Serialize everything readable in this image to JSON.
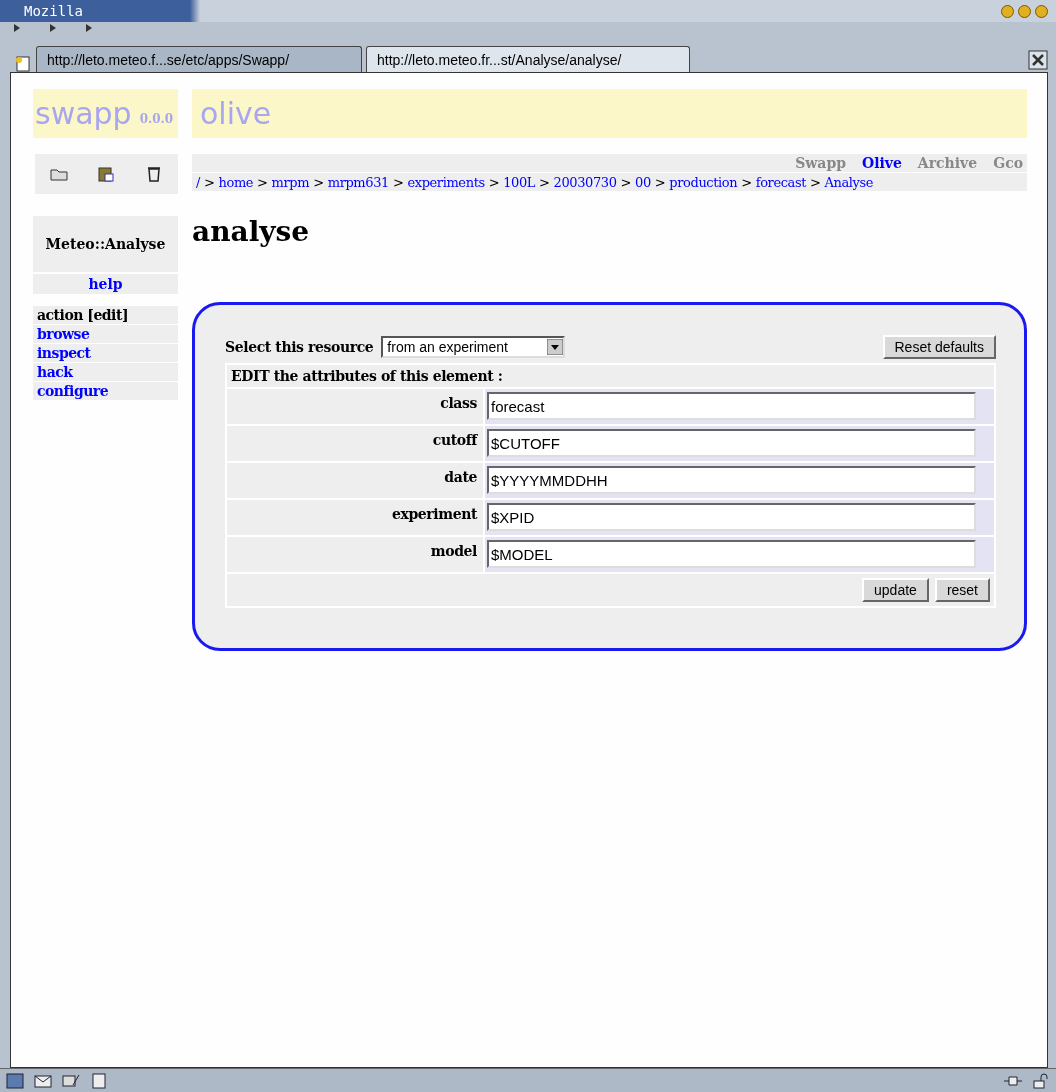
{
  "window": {
    "title": "Mozilla"
  },
  "tabs": [
    {
      "label": "http://leto.meteo.f...se/etc/apps/Swapp/",
      "selected": false
    },
    {
      "label": "http://leto.meteo.fr...st/Analyse/analyse/",
      "selected": true
    }
  ],
  "header": {
    "logo": "swapp",
    "version": "0.0.0",
    "title": "olive"
  },
  "nav": [
    {
      "label": "Swapp",
      "selected": false
    },
    {
      "label": "Olive",
      "selected": true
    },
    {
      "label": "Archive",
      "selected": false
    },
    {
      "label": "Gco",
      "selected": false
    }
  ],
  "breadcrumb": {
    "separator": ">",
    "items": [
      "/",
      "home",
      "mrpm",
      "mrpm631",
      "experiments",
      "100L",
      "20030730",
      "00",
      "production",
      "forecast",
      "Analyse"
    ]
  },
  "sidebar": {
    "module": "Meteo::Analyse",
    "help": "help",
    "actions": [
      {
        "label": "action [edit]",
        "selected": true
      },
      {
        "label": "browse",
        "selected": false
      },
      {
        "label": "inspect",
        "selected": false
      },
      {
        "label": "hack",
        "selected": false
      },
      {
        "label": "configure",
        "selected": false
      }
    ]
  },
  "heading": "analyse",
  "form": {
    "select_label": "Select this resource",
    "select_value": "from an experiment",
    "reset_defaults": "Reset defaults",
    "section": "EDIT the attributes of this element :",
    "fields": [
      {
        "label": "class",
        "value": "forecast"
      },
      {
        "label": "cutoff",
        "value": "$CUTOFF"
      },
      {
        "label": "date",
        "value": "$YYYYMMDDHH"
      },
      {
        "label": "experiment",
        "value": "$XPID"
      },
      {
        "label": "model",
        "value": "$MODEL"
      }
    ],
    "buttons": [
      "update",
      "reset"
    ]
  }
}
